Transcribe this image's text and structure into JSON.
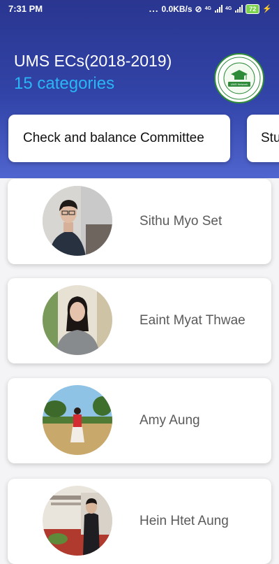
{
  "status_bar": {
    "time": "7:31 PM",
    "dots": "...",
    "net_speed": "0.0KB/s",
    "network": "4G",
    "battery": "72"
  },
  "header": {
    "title": "UMS ECs(2018-2019)",
    "subtitle": "15 categories",
    "logo_text": "UMS Network"
  },
  "categories": [
    {
      "label": "Check and balance Committee"
    },
    {
      "label": "Stu"
    }
  ],
  "members": [
    {
      "name": "Sithu Myo Set"
    },
    {
      "name": "Eaint Myat Thwae"
    },
    {
      "name": "Amy Aung"
    },
    {
      "name": "Hein Htet Aung"
    }
  ],
  "colors": {
    "header_top": "#2a3690",
    "header_bottom": "#5065cf",
    "subtitle": "#29b6f6",
    "logo_green": "#2e8b3a"
  }
}
